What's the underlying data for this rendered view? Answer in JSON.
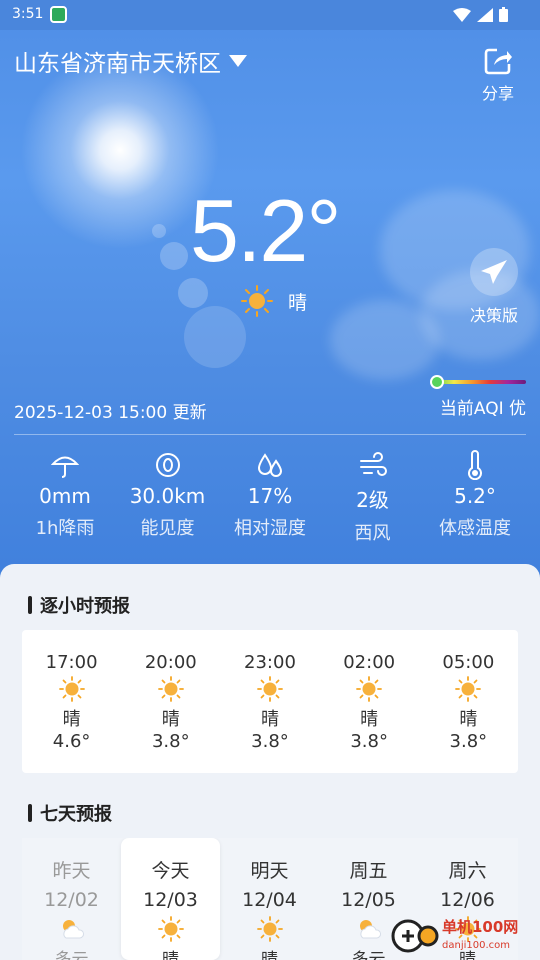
{
  "status_bar": {
    "time": "3:51"
  },
  "header": {
    "location": "山东省济南市天桥区",
    "share_label": "分享"
  },
  "current": {
    "temperature": "5.2°",
    "condition": "晴",
    "decision_label": "决策版",
    "updated": "2025-12-03 15:00 更新",
    "aqi": "当前AQI 优"
  },
  "metrics": [
    {
      "icon": "umbrella-icon",
      "value": "0mm",
      "label": "1h降雨"
    },
    {
      "icon": "eye-icon",
      "value": "30.0km",
      "label": "能见度"
    },
    {
      "icon": "water-drops-icon",
      "value": "17%",
      "label": "相对湿度"
    },
    {
      "icon": "wind-icon",
      "value": "2级",
      "label": "西风"
    },
    {
      "icon": "thermometer-icon",
      "value": "5.2°",
      "label": "体感温度"
    }
  ],
  "hourly": {
    "title": "逐小时预报",
    "items": [
      {
        "time": "17:00",
        "cond": "晴",
        "temp": "4.6°"
      },
      {
        "time": "20:00",
        "cond": "晴",
        "temp": "3.8°"
      },
      {
        "time": "23:00",
        "cond": "晴",
        "temp": "3.8°"
      },
      {
        "time": "02:00",
        "cond": "晴",
        "temp": "3.8°"
      },
      {
        "time": "05:00",
        "cond": "晴",
        "temp": "3.8°"
      }
    ]
  },
  "weekly": {
    "title": "七天预报",
    "items": [
      {
        "day": "昨天",
        "date": "12/02",
        "cond": "多云",
        "icon": "partly-cloudy-icon"
      },
      {
        "day": "今天",
        "date": "12/03",
        "cond": "晴",
        "icon": "sun-icon"
      },
      {
        "day": "明天",
        "date": "12/04",
        "cond": "晴",
        "icon": "sun-icon"
      },
      {
        "day": "周五",
        "date": "12/05",
        "cond": "多云",
        "icon": "partly-cloudy-icon"
      },
      {
        "day": "周六",
        "date": "12/06",
        "cond": "晴",
        "icon": "sun-icon"
      }
    ]
  },
  "watermark": {
    "title": "单机100网",
    "site": "danji100.com"
  },
  "colors": {
    "sky": "#4f8ee6",
    "sun": "#f5a623",
    "aqi_good": "#57d35b"
  }
}
